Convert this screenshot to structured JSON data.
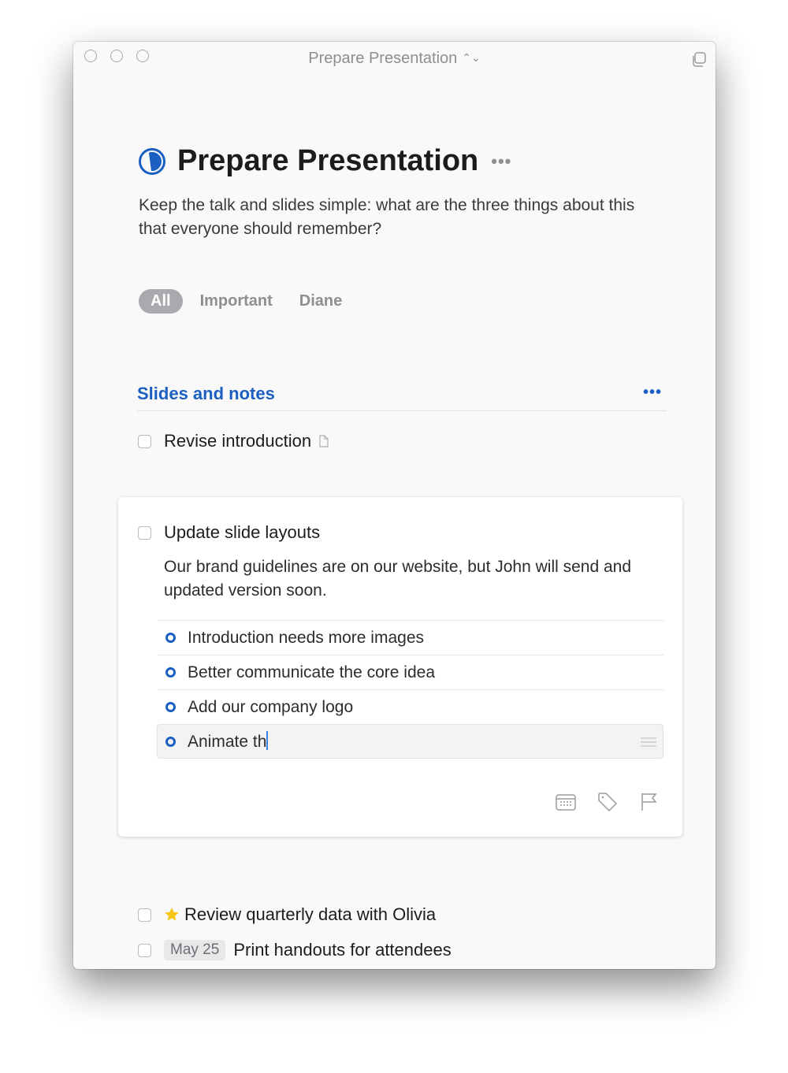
{
  "window": {
    "title": "Prepare Presentation"
  },
  "project": {
    "title": "Prepare Presentation",
    "notes": "Keep the talk and slides simple: what are the three things about this that everyone should remember?",
    "accent_color": "#1a5fc1"
  },
  "filters": [
    {
      "label": "All",
      "active": true
    },
    {
      "label": "Important",
      "active": false
    },
    {
      "label": "Diane",
      "active": false
    }
  ],
  "heading": {
    "title": "Slides and notes"
  },
  "todos": {
    "revise": {
      "title": "Revise introduction",
      "has_notes": true
    },
    "expanded": {
      "title": "Update slide layouts",
      "notes": "Our brand guidelines are on our website, but John will send and updated version soon.",
      "checklist": [
        {
          "text": "Introduction needs more images"
        },
        {
          "text": "Better communicate the core idea"
        },
        {
          "text": "Add our company logo"
        },
        {
          "text": "Animate th",
          "editing": true
        }
      ]
    },
    "review": {
      "title": "Review quarterly data with Olivia",
      "starred": true,
      "star_color": "#f5c518"
    },
    "print": {
      "title": "Print handouts for attendees",
      "date": "May 25"
    }
  }
}
